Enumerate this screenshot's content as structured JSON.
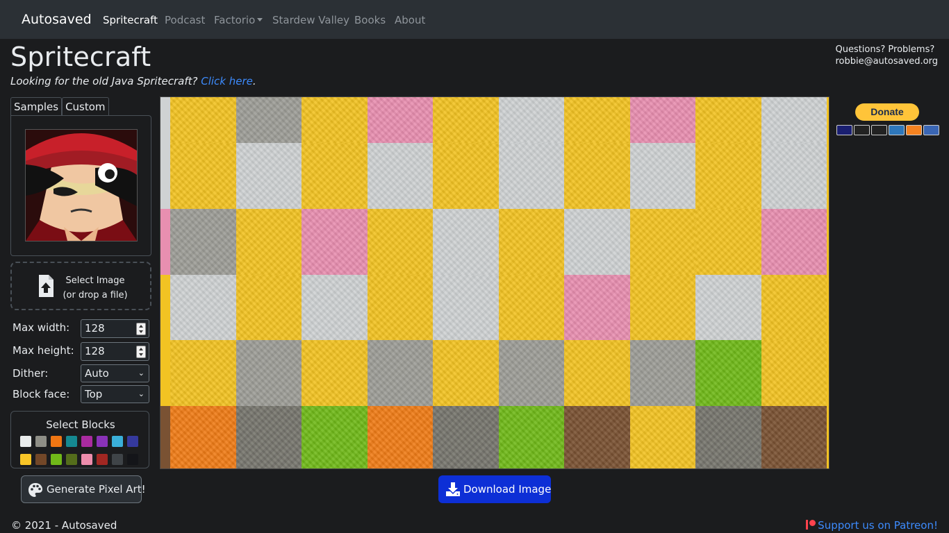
{
  "navbar": {
    "brand": "Autosaved",
    "links": [
      {
        "label": "Spritecraft",
        "active": true
      },
      {
        "label": "Podcast"
      },
      {
        "label": "Factorio",
        "dropdown": true
      },
      {
        "label": "Stardew Valley"
      },
      {
        "label": "Books"
      },
      {
        "label": "About"
      }
    ]
  },
  "header": {
    "title": "Spritecraft",
    "subtitle_prefix": "Looking for the old Java Spritecraft? ",
    "subtitle_link": "Click here",
    "subtitle_suffix": ".",
    "contact_line1": "Questions? Problems?",
    "contact_email": "robbie@autosaved.org"
  },
  "image_panel": {
    "tabs": [
      {
        "label": "Samples"
      },
      {
        "label": "Custom",
        "active": true
      }
    ],
    "select_label": "Select Image",
    "drop_hint": "(or drop a file)"
  },
  "settings": {
    "max_width_label": "Max width:",
    "max_width_value": "128",
    "max_height_label": "Max height:",
    "max_height_value": "128",
    "dither_label": "Dither:",
    "dither_value": "Auto",
    "block_face_label": "Block face:",
    "block_face_value": "Top"
  },
  "blocks": {
    "title": "Select Blocks",
    "swatch_colors": [
      "#e9ecec",
      "#8e8e86",
      "#f07613",
      "#158991",
      "#a92ba0",
      "#8932b8",
      "#3aafd9",
      "#35399d",
      "#f8c527",
      "#724728",
      "#70b919",
      "#546d1b",
      "#ed8dac",
      "#a12722",
      "#3f4448",
      "#141519"
    ]
  },
  "actions": {
    "generate_label": "Generate Pixel Art!",
    "download_label": "Download Image"
  },
  "canvas": {
    "block_colors": {
      "Y": "#f2c323",
      "W": "#cfd2d3",
      "G": "#9d9d97",
      "P": "#e88fb0",
      "D": "#76756d",
      "L": "#70b919",
      "O": "#ef7c17",
      "B": "#7a5233"
    },
    "rows": [
      "YGYPYWYPYW",
      "YWYWYWYWYW",
      "GYPYWYWYYP",
      "WYWYWYPYWY",
      "YGYGYGYGLY",
      "ODLODLBYDB"
    ]
  },
  "donate": {
    "button_label": "Donate",
    "cards": [
      {
        "name": "VISA",
        "color": "#1a1f71"
      },
      {
        "name": "MC",
        "color": "#222222"
      },
      {
        "name": "MAESTRO",
        "color": "#222222"
      },
      {
        "name": "AMEX",
        "color": "#2e77bb"
      },
      {
        "name": "DISCOVER",
        "color": "#f58220"
      },
      {
        "name": "CC",
        "color": "#3a66b4"
      }
    ]
  },
  "footer": {
    "copyright": "© 2021 - Autosaved",
    "patreon": "Support us on Patreon!"
  }
}
